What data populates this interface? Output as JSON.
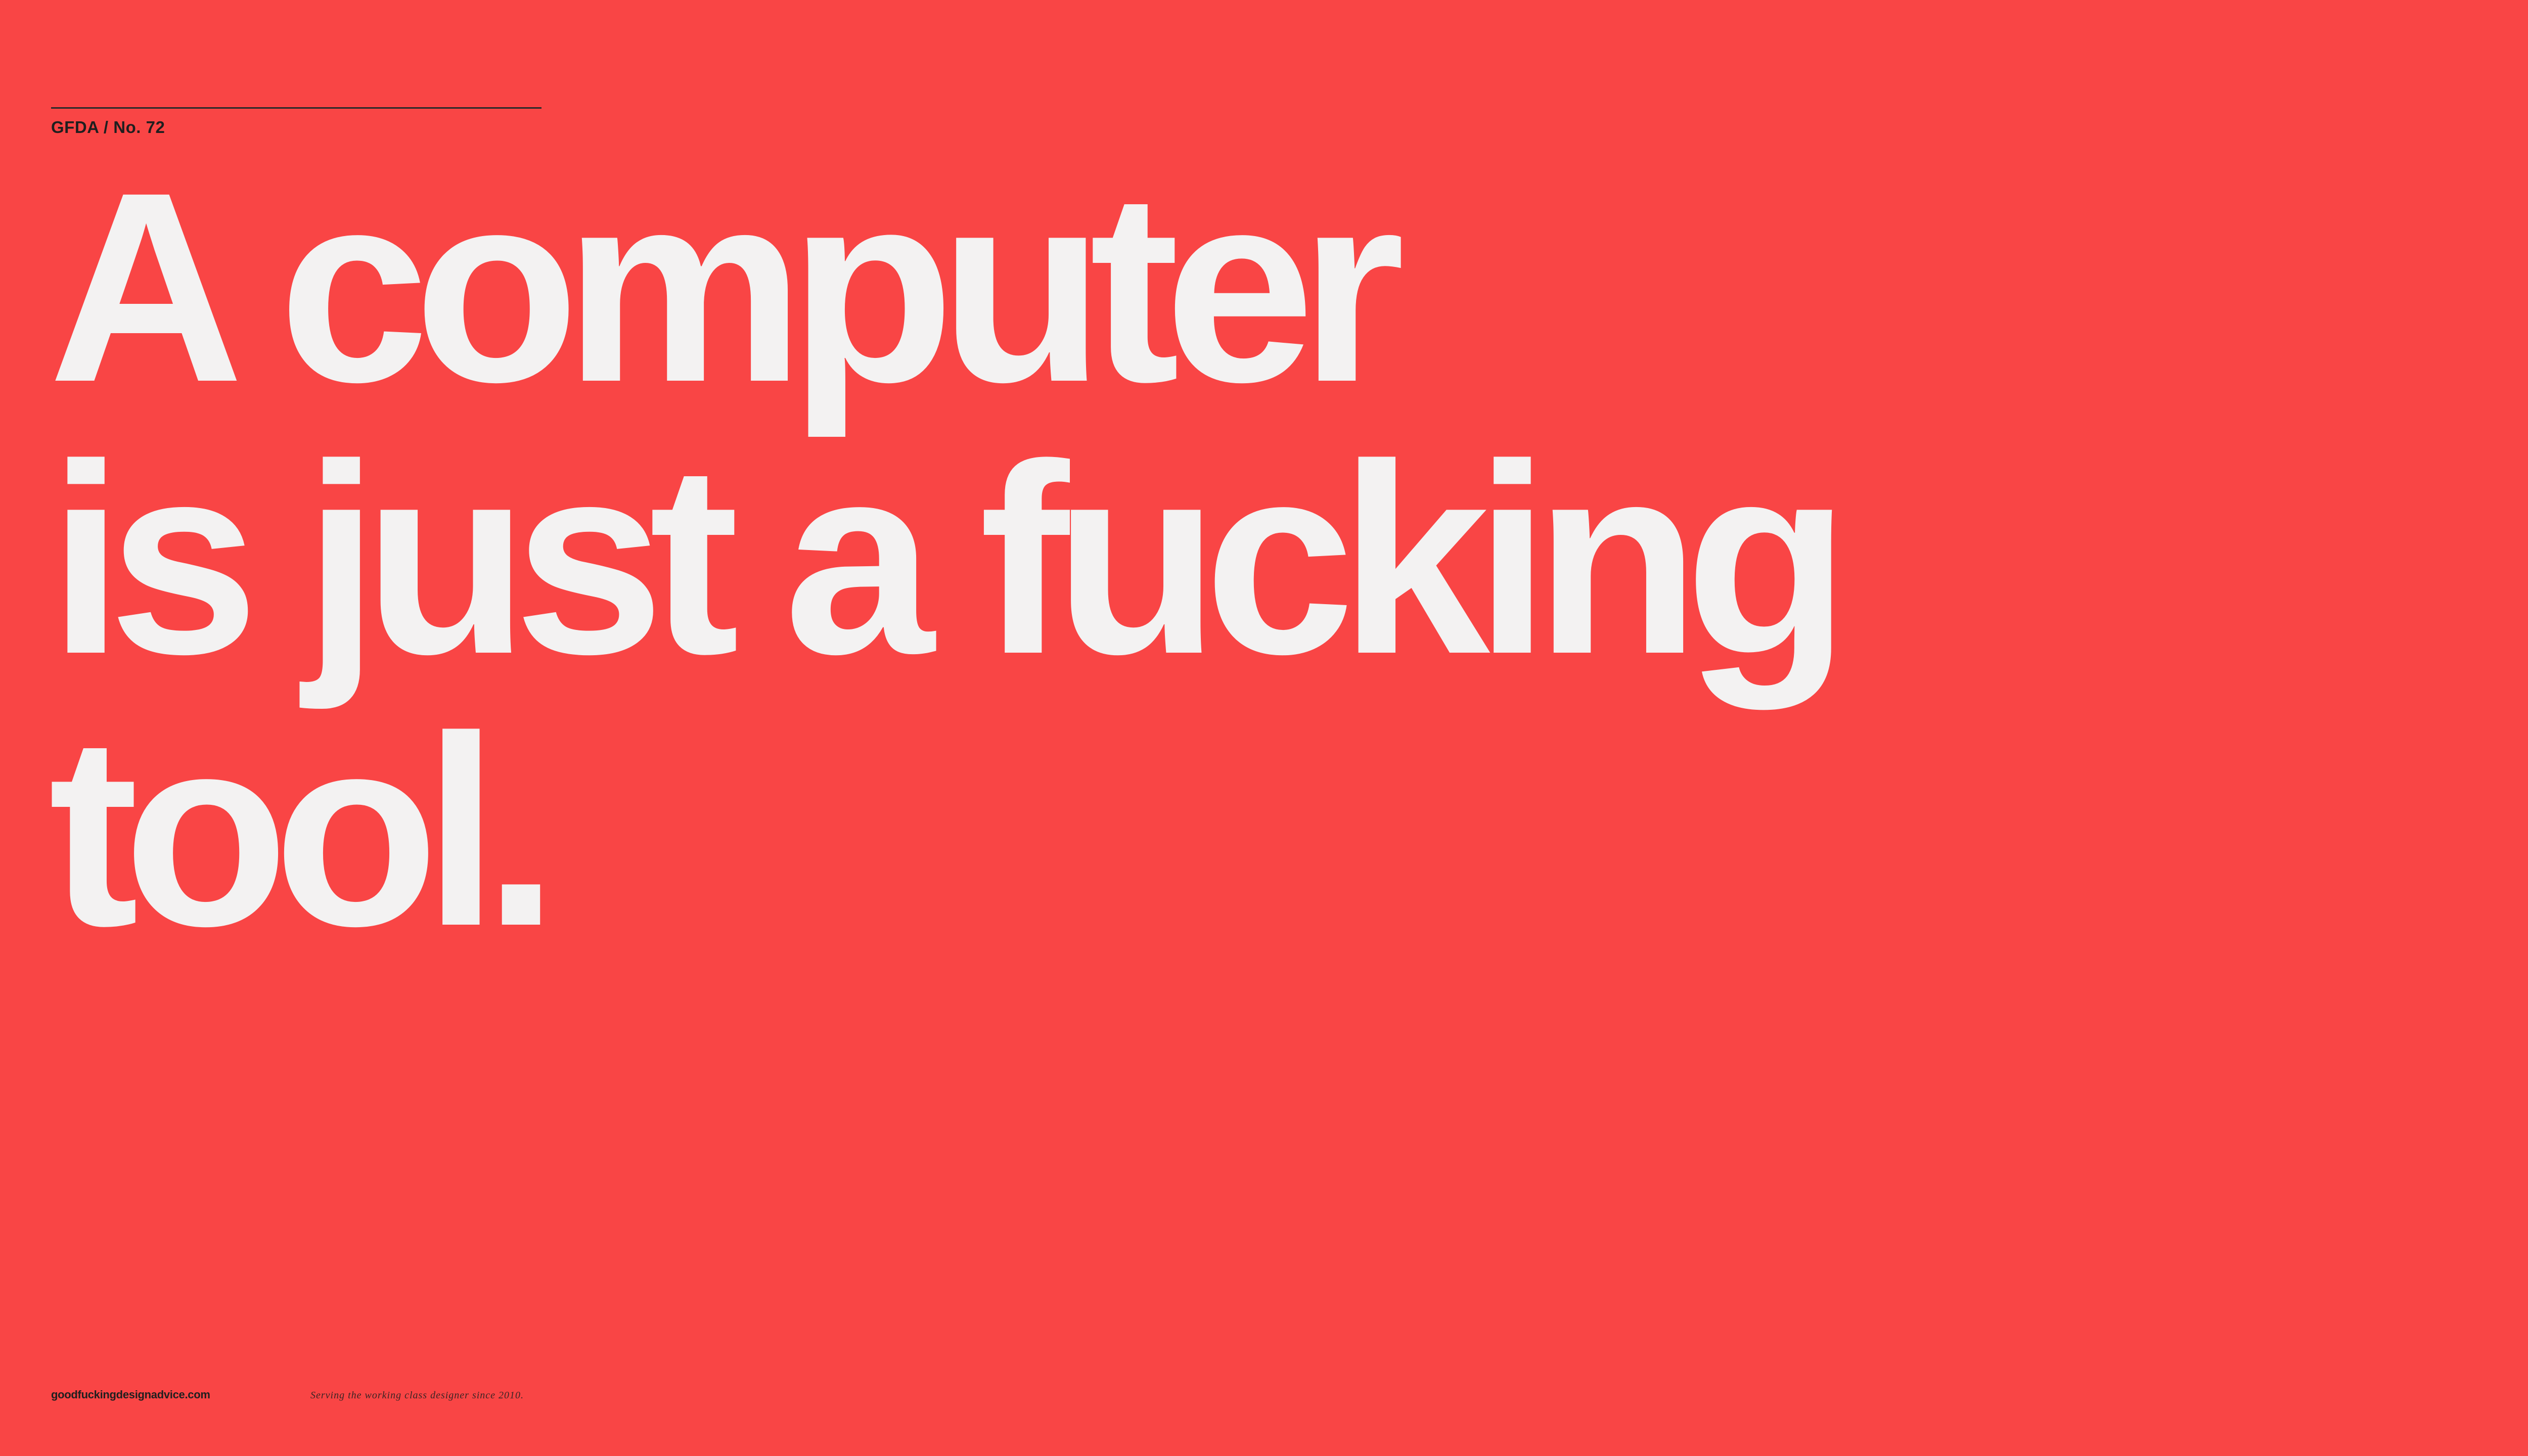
{
  "header": {
    "issue_label": "GFDA / No. 72"
  },
  "headline": {
    "lines": [
      "A computer",
      "is just a fucking",
      "tool."
    ]
  },
  "footer": {
    "site": "goodfuckingdesignadvice.com",
    "tagline": "Serving the working class designer since 2010."
  },
  "colors": {
    "background": "#f94545",
    "headline_text": "#f3f2f2",
    "small_text": "#1f1f1f"
  }
}
